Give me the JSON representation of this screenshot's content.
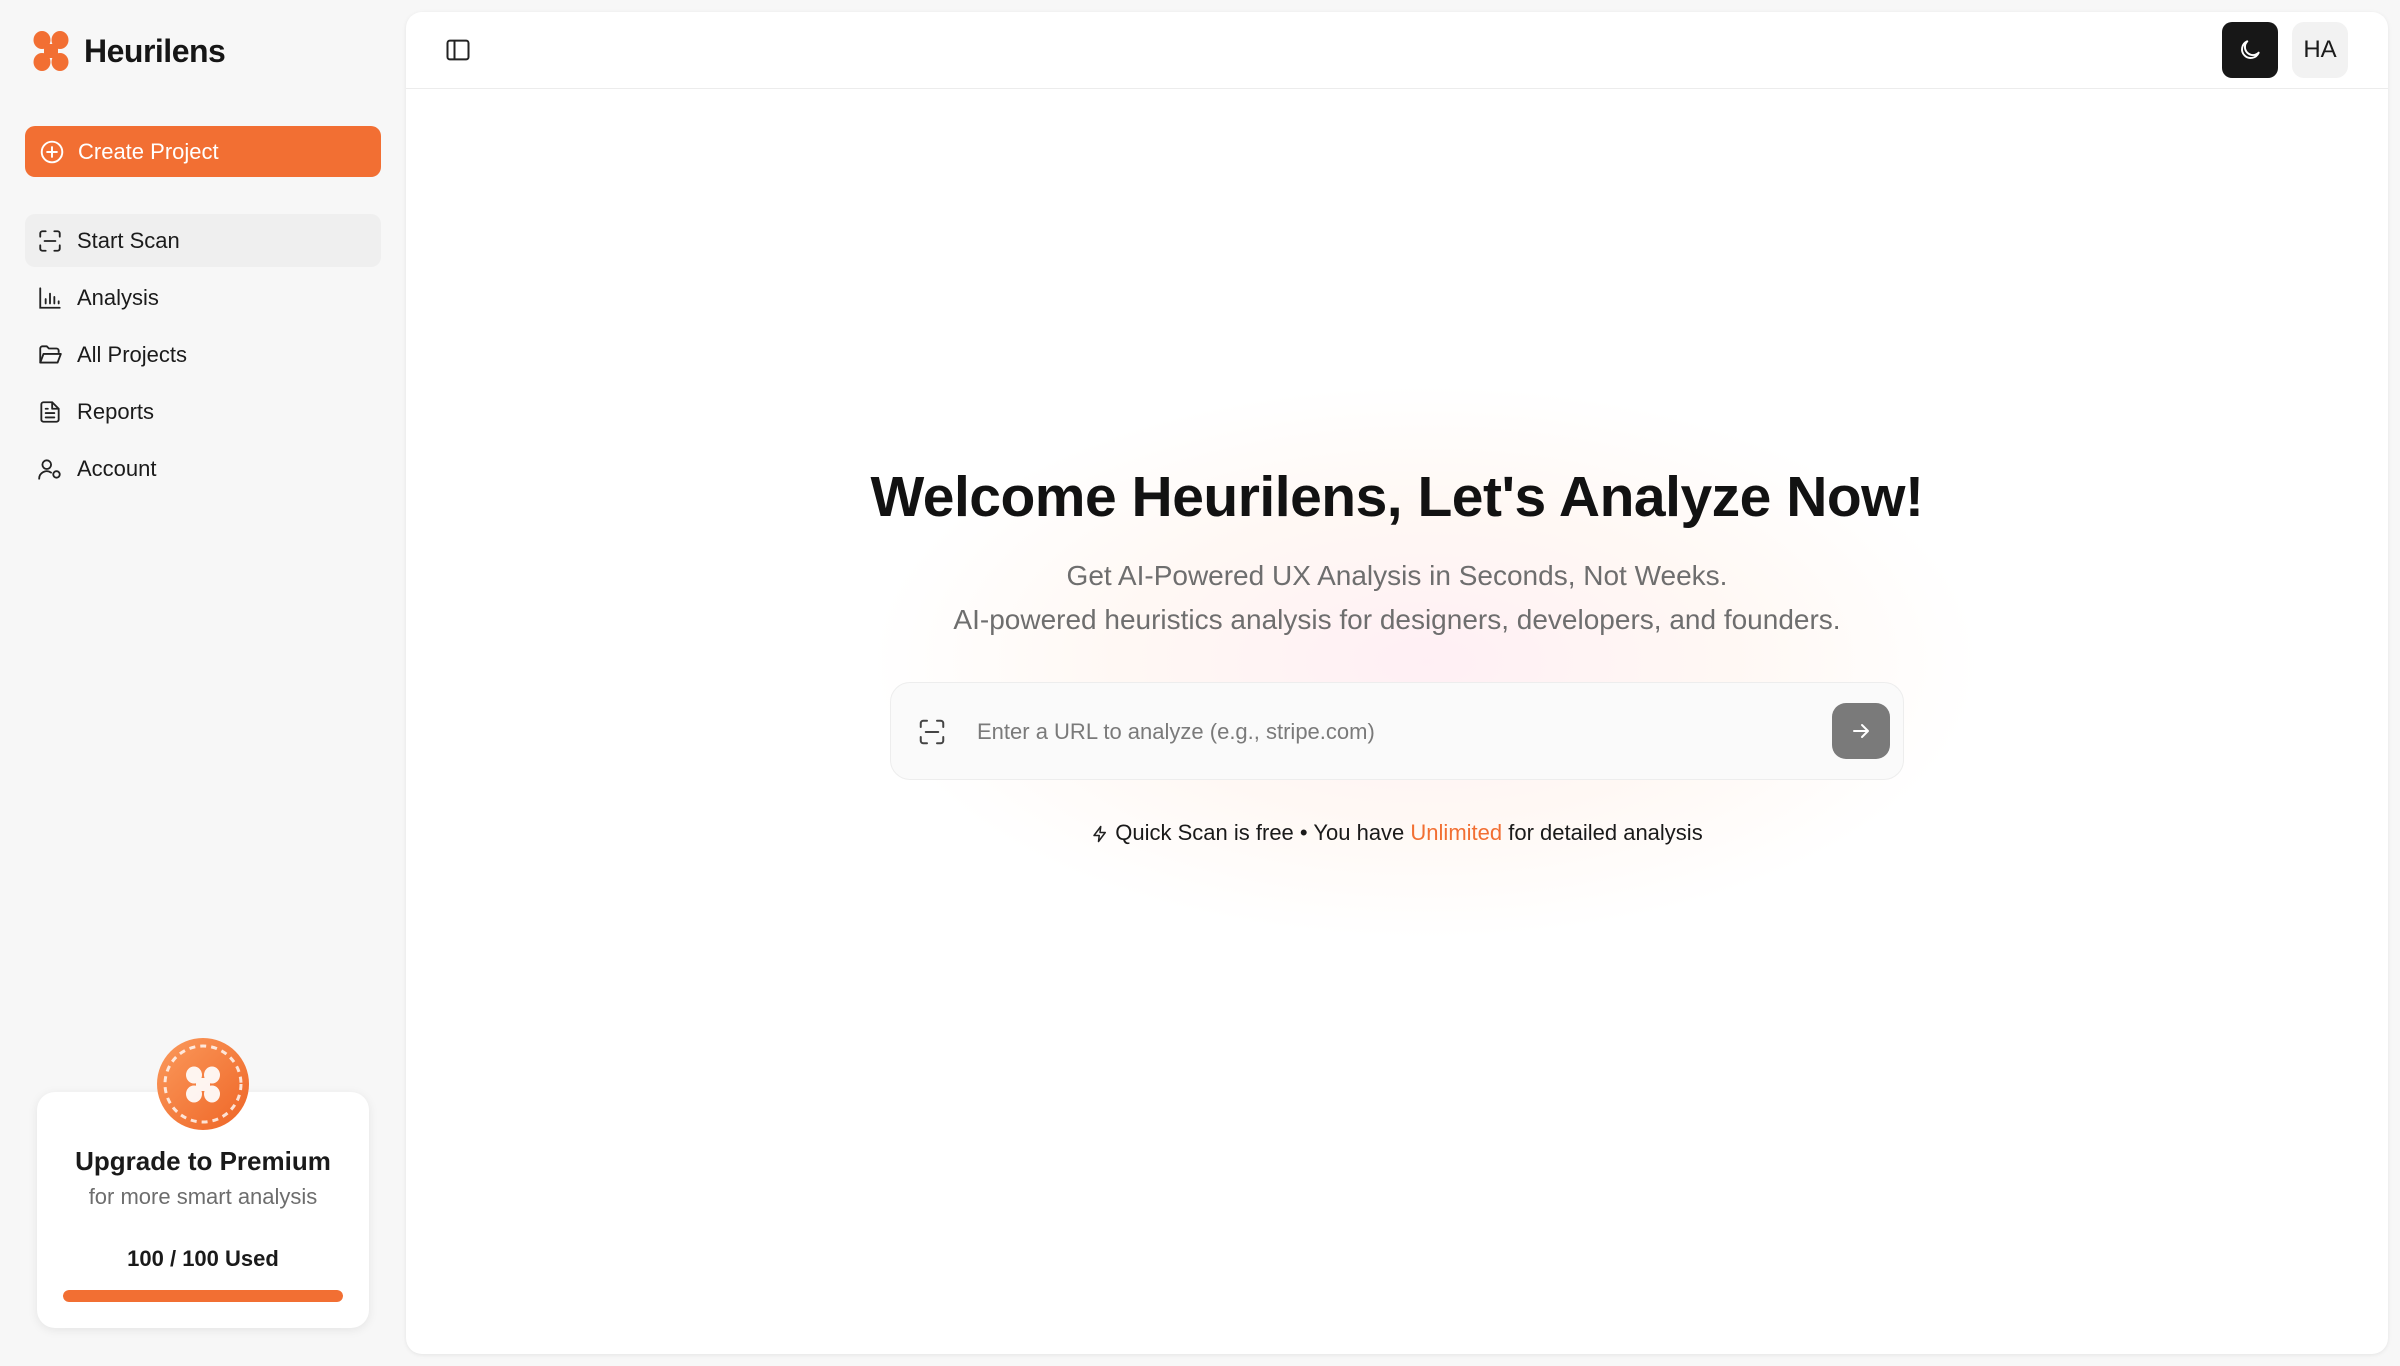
{
  "brand": {
    "name": "Heurilens",
    "accent_color": "#f26f33"
  },
  "sidebar": {
    "create_button": "Create Project",
    "items": [
      {
        "label": "Start Scan",
        "icon": "scan-icon",
        "active": true
      },
      {
        "label": "Analysis",
        "icon": "bar-chart-icon",
        "active": false
      },
      {
        "label": "All Projects",
        "icon": "folder-open-icon",
        "active": false
      },
      {
        "label": "Reports",
        "icon": "file-text-icon",
        "active": false
      },
      {
        "label": "Account",
        "icon": "user-cog-icon",
        "active": false
      }
    ],
    "upgrade": {
      "title": "Upgrade to Premium",
      "subtitle": "for more smart analysis",
      "usage": "100 / 100 Used",
      "usage_fraction": 1.0
    }
  },
  "topbar": {
    "panel_toggle_icon": "panel-left-icon",
    "theme_icon": "moon-icon",
    "avatar_initials": "HA"
  },
  "hero": {
    "title": "Welcome Heurilens, Let's Analyze Now!",
    "subtitle_1": "Get AI-Powered UX Analysis in Seconds, Not Weeks.",
    "subtitle_2": "AI-powered heuristics analysis for designers, developers, and founders."
  },
  "search": {
    "placeholder": "Enter a URL to analyze (e.g., stripe.com)",
    "value": ""
  },
  "note": {
    "part1": "Quick Scan is free",
    "separator": "•",
    "part2": "You have",
    "highlight": "Unlimited",
    "part3": "for detailed analysis"
  }
}
